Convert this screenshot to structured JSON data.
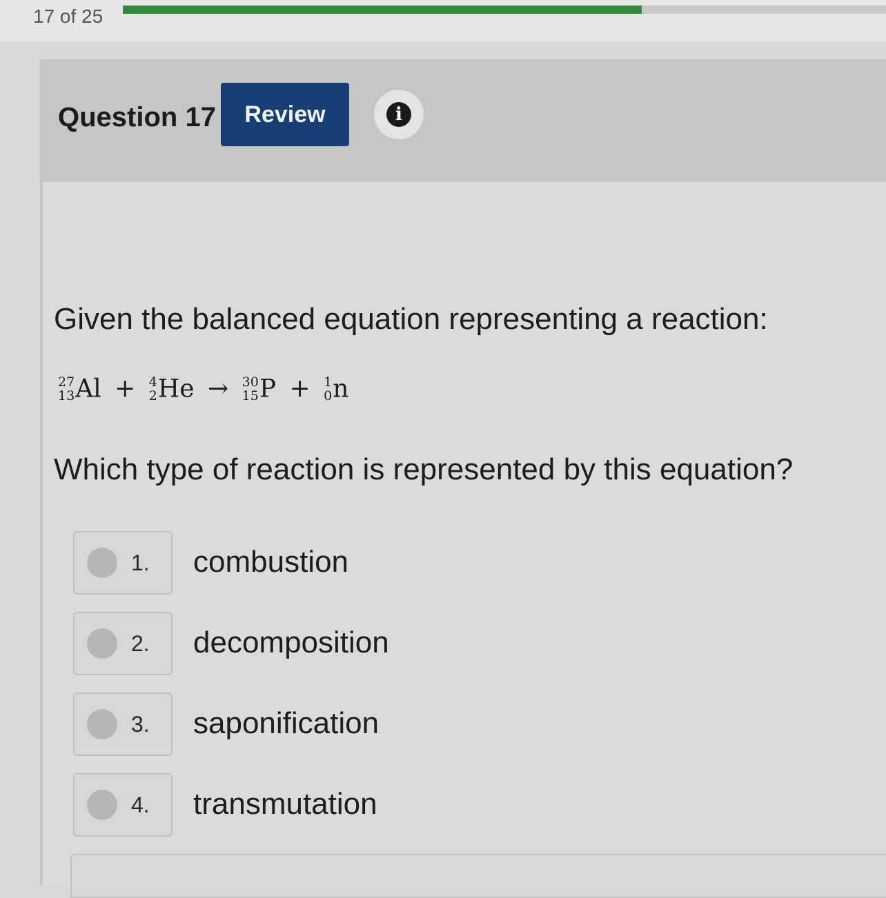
{
  "progress": {
    "label": "17 of 25",
    "fraction": 0.68,
    "color": "#2e8b3a"
  },
  "header": {
    "question_label": "Question 17",
    "review_label": "Review",
    "info_icon": "i"
  },
  "question": {
    "prompt": "Given the balanced equation representing a reaction:",
    "equation": {
      "reactant1": {
        "mass": "27",
        "atomic": "13",
        "symbol": "Al"
      },
      "plus1": "+",
      "reactant2": {
        "mass": "4",
        "atomic": "2",
        "symbol": "He"
      },
      "arrow": "→",
      "product1": {
        "mass": "30",
        "atomic": "15",
        "symbol": "P"
      },
      "plus2": "+",
      "product2": {
        "mass": "1",
        "atomic": "0",
        "symbol": "n"
      }
    },
    "text": "Which type of reaction is represented by this equation?"
  },
  "choices": [
    {
      "number": "1.",
      "label": "combustion"
    },
    {
      "number": "2.",
      "label": "decomposition"
    },
    {
      "number": "3.",
      "label": "saponification"
    },
    {
      "number": "4.",
      "label": "transmutation"
    }
  ],
  "colors": {
    "review_button": "#163f78",
    "progress": "#2e8b3a"
  }
}
